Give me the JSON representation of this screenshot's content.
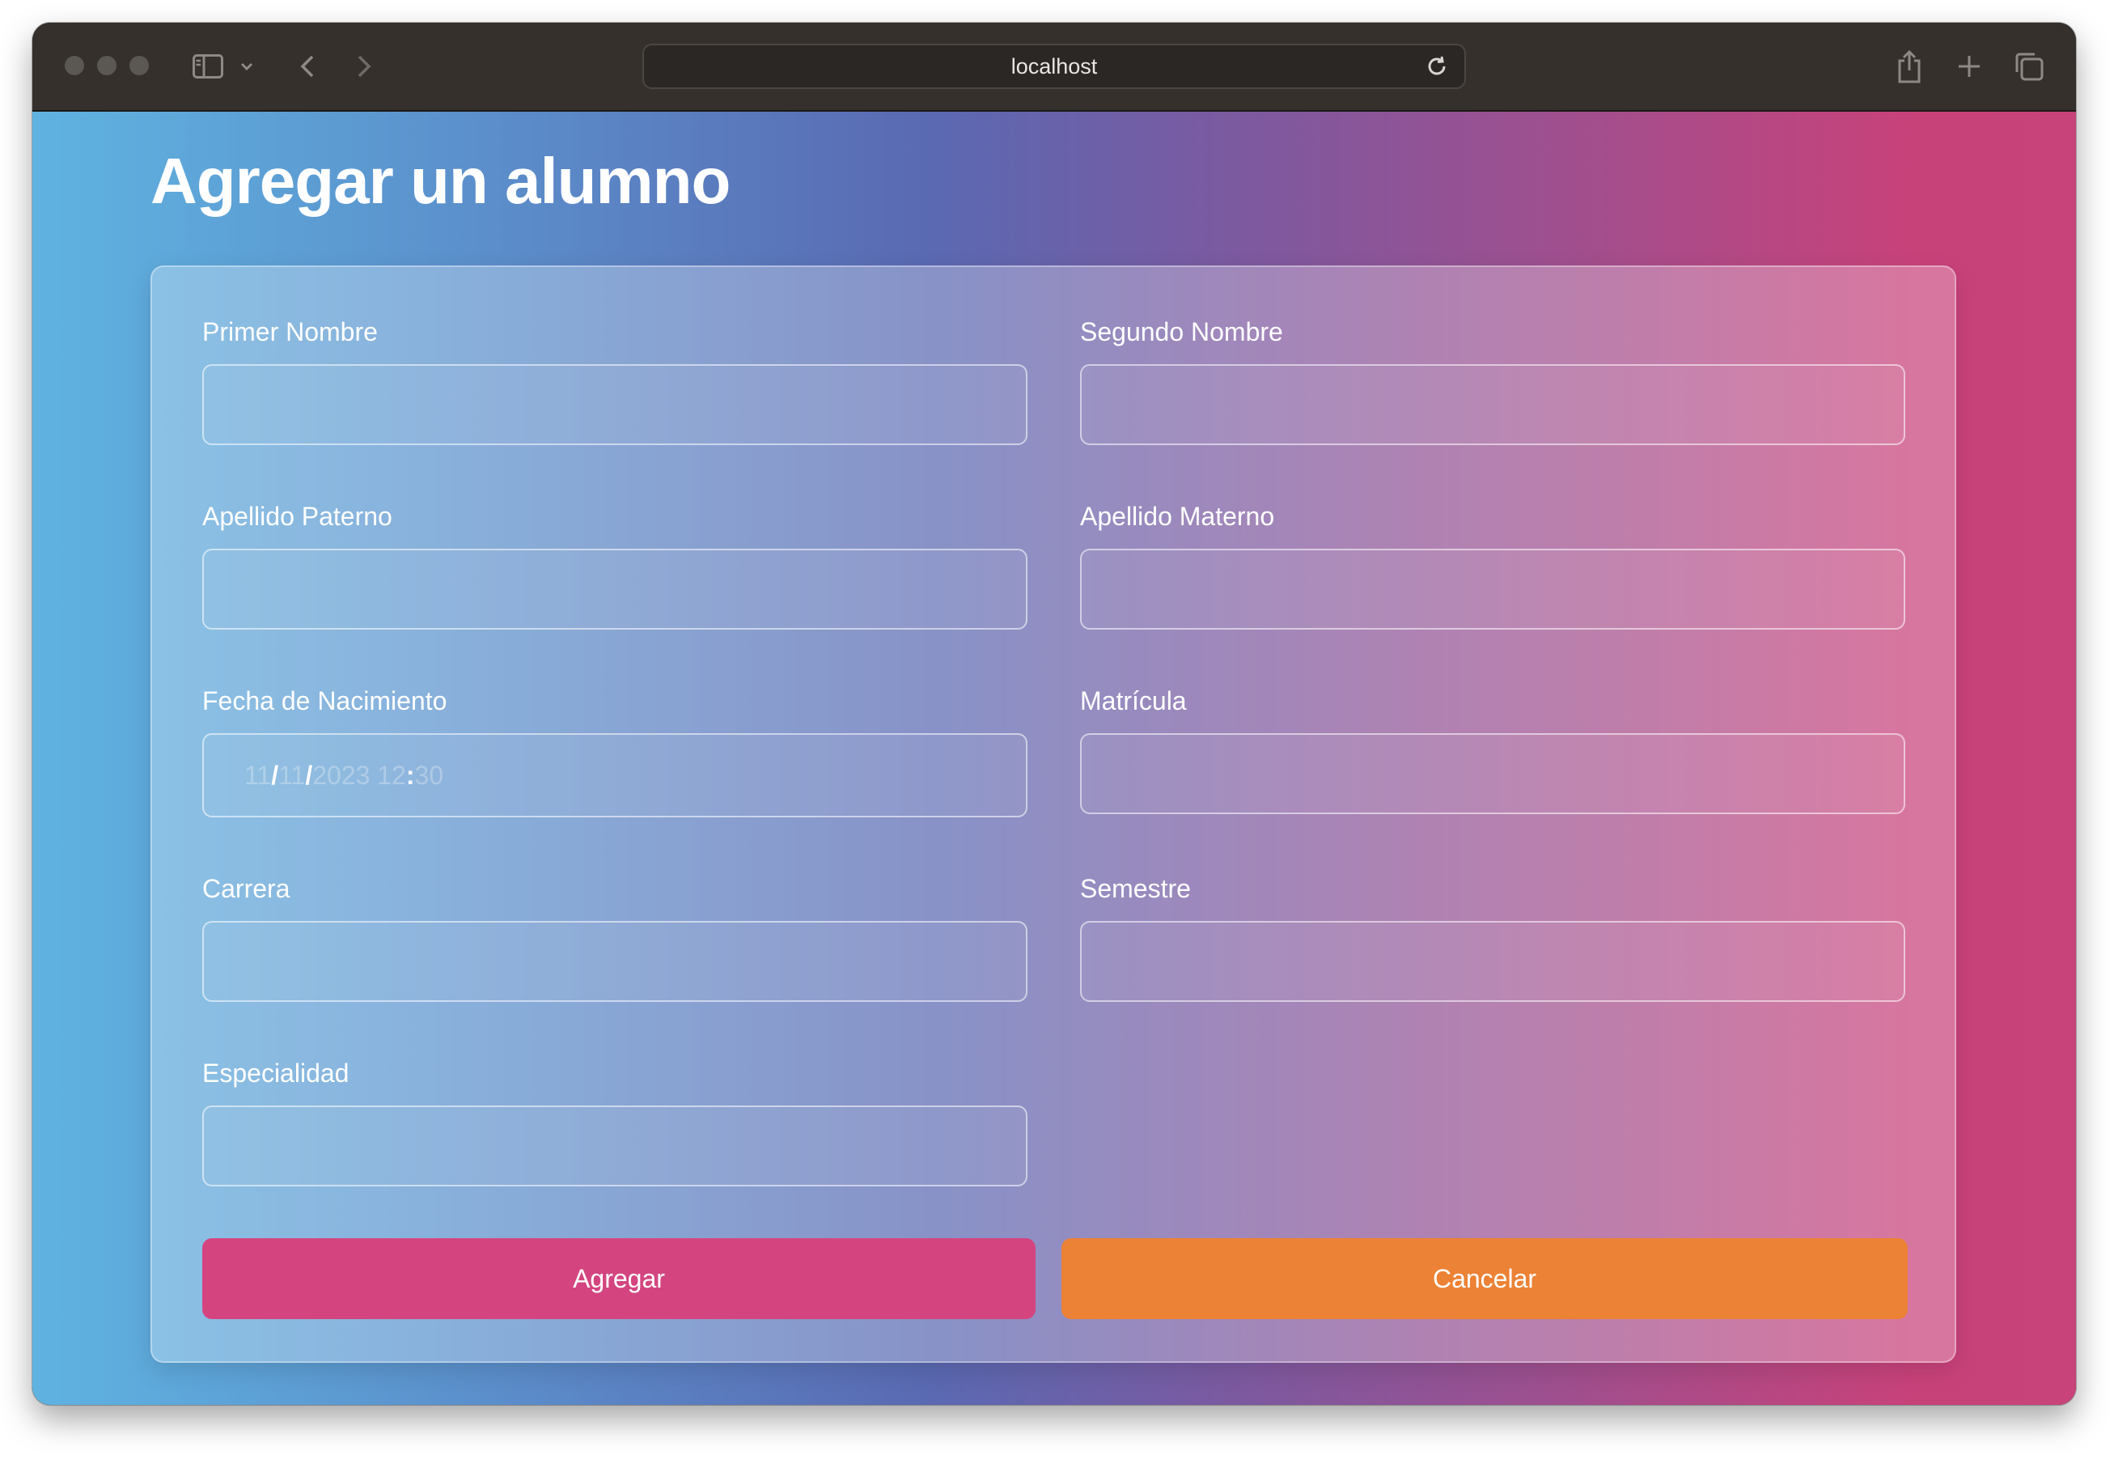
{
  "browser": {
    "url": "localhost",
    "icons": {
      "sidebar": "sidebar-icon",
      "dropdown": "chevron-down-icon",
      "back": "chevron-left-icon",
      "forward": "chevron-right-icon",
      "reload": "reload-icon",
      "share": "share-icon",
      "new_tab": "plus-icon",
      "tabs": "tabs-overview-icon"
    }
  },
  "page": {
    "title": "Agregar un alumno"
  },
  "form": {
    "fields": {
      "primer_nombre": {
        "label": "Primer Nombre",
        "value": ""
      },
      "segundo_nombre": {
        "label": "Segundo Nombre",
        "value": ""
      },
      "apellido_paterno": {
        "label": "Apellido Paterno",
        "value": ""
      },
      "apellido_materno": {
        "label": "Apellido Materno",
        "value": ""
      },
      "fecha_nacimiento": {
        "label": "Fecha de Nacimiento",
        "day": "11",
        "month": "11",
        "year": "2023",
        "hour": "12",
        "minute": "30",
        "date_sep": "/",
        "time_sep": ":"
      },
      "matricula": {
        "label": "Matrícula",
        "value": ""
      },
      "carrera": {
        "label": "Carrera",
        "value": ""
      },
      "semestre": {
        "label": "Semestre",
        "value": ""
      },
      "especialidad": {
        "label": "Especialidad",
        "value": ""
      }
    },
    "buttons": {
      "add": "Agregar",
      "cancel": "Cancelar"
    }
  },
  "colors": {
    "add_button": "#d44580",
    "cancel_button": "#ec8235",
    "gradient_start": "#5fb3e1",
    "gradient_end": "#c8437a"
  }
}
